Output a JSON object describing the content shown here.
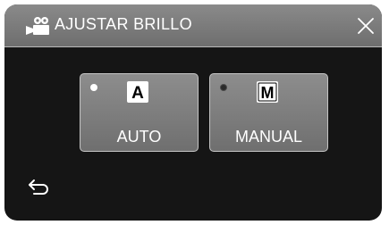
{
  "header": {
    "title": "AJUSTAR BRILLO",
    "mode_icon": "video-camera-icon",
    "close_icon": "close-icon"
  },
  "options": [
    {
      "label": "AUTO",
      "icon_letter": "A",
      "selected": true
    },
    {
      "label": "MANUAL",
      "icon_letter": "M",
      "selected": false
    }
  ],
  "footer": {
    "back_icon": "return-arrow-icon"
  },
  "colors": {
    "panel_background": "#151515",
    "header_background": "#7c7c7c",
    "button_background": "#7e7e7e",
    "text": "#ffffff"
  }
}
